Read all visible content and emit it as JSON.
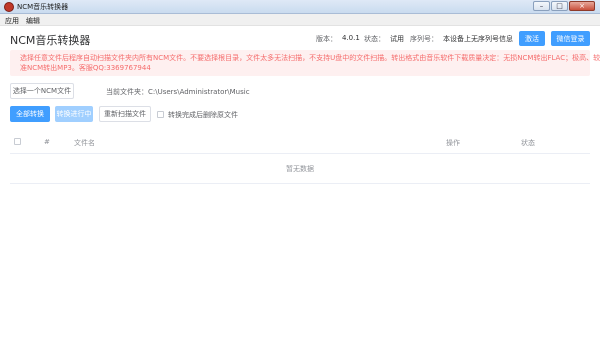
{
  "window": {
    "title": "NCM音乐转换器",
    "icon": "app-icon",
    "controls": {
      "minimize": "–",
      "maximize": "□",
      "close": "×"
    }
  },
  "menu": [
    "应用",
    "编辑"
  ],
  "header": {
    "app_title": "NCM音乐转换器",
    "version_label": "版本：",
    "version_value": "4.0.1",
    "status_label": "状态：",
    "status_value": "试用",
    "serial_label": "序列号：",
    "serial_value": "本设备上无序列号信息",
    "activate_button": "激活",
    "wechat_login_button": "微信登录"
  },
  "alert": {
    "line1": "选择任意文件后程序自动扫描文件夹内所有NCM文件。不要选择根目录，文件太多无法扫描，不支持U盘中的文件扫描。转出格式由音乐软件下载质量决定：无损NCM转出FLAC；极高、较高、标",
    "line2": "准NCM转出MP3。客服QQ:3369767944"
  },
  "toolbar": {
    "select_file_button": "选择一个NCM文件",
    "current_folder_label": "当前文件夹：",
    "current_folder_path": "C:\\Users\\Administrator\\Music",
    "convert_all_button": "全部转换",
    "converting_button": "转换进行中",
    "rescan_button": "重新扫描文件",
    "delete_after_label": "转换完成后删除原文件"
  },
  "table": {
    "columns": {
      "index": "#",
      "filename": "文件名",
      "action": "操作",
      "status": "状态"
    },
    "empty_text": "暂无数据"
  },
  "colors": {
    "primary": "#409eff",
    "primary_disabled": "#a0cfff",
    "alert_bg": "#fef0f0",
    "alert_text": "#f56c6c"
  }
}
